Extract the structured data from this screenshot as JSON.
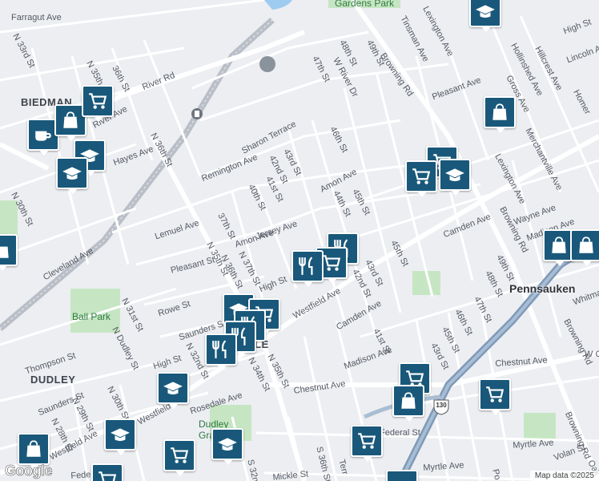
{
  "map": {
    "streets": [
      "Farragut Ave",
      "N 33rd St",
      "N 35th St",
      "36th St",
      "River Ave",
      "River Rd",
      "Hayes Ave",
      "N 36th St",
      "N 30th St",
      "Cleveland Ave",
      "Lemuel Ave",
      "Pleasant St",
      "N 35th St",
      "N 36th St",
      "37th St",
      "N 37th St",
      "Amon Ave",
      "Jersey Ave",
      "High St",
      "Rowe St",
      "N 31st St",
      "N Dudley St",
      "Saunders St",
      "N 32nd St",
      "N 34th St",
      "N 35th St",
      "High St",
      "Thompson St",
      "Saunders St",
      "N 30th St",
      "N 29th St",
      "N 28th St",
      "Westfield Ave",
      "Rosedale Ave",
      "Westfield Ave",
      "Sharon Terrace",
      "Remington Ave",
      "42nd St",
      "43rd St",
      "41st St",
      "40th St",
      "Amon Ave",
      "44th St",
      "45th St",
      "46th St",
      "47th St",
      "48th St",
      "W River Dr",
      "49th St",
      "Browning Rd",
      "Tinsman Ave",
      "Lexington Ave",
      "Pleasant Ave",
      "Gross Ave",
      "Hollinshed Ave",
      "Hillcrest Ave",
      "High St",
      "Lincoln Ave",
      "Homer",
      "Merchantville Ave",
      "Lexington Ave",
      "Wayne Ave",
      "Camden Ave",
      "Madison Ave",
      "Browning Rd",
      "49th St",
      "48th St",
      "47th St",
      "45th St",
      "43rd St",
      "42nd St",
      "Camden Ave",
      "41st St",
      "Madison Ave",
      "45th St",
      "46th St",
      "43rd St",
      "Chestnut Ave",
      "Chestnut Ave",
      "W C",
      "Whitman",
      "Browning Rd",
      "Federal St",
      "Myrtle Ave",
      "Myrtle Ave",
      "Volan St",
      "Mickle St",
      "S 36th St",
      "S 32nd",
      "Terr",
      "Oak",
      "Po",
      "Browning Rd",
      "Fede",
      "Westfield Ave"
    ],
    "areas": [
      "BIEDMAN",
      "DUDLEY"
    ],
    "cities": [
      "Pennsauken"
    ],
    "parks": [
      "Gardens Park",
      "Ball Park",
      "Dudley Grange"
    ],
    "route_shield": "130",
    "partial_label": "LE"
  },
  "footer": {
    "attribution": "Map data ©2025",
    "logo": "Google"
  },
  "colors": {
    "pin": "#19587a",
    "park": "#c6e6c3",
    "highway": "#7e9ab9",
    "road": "#ffffff"
  },
  "pins": [
    {
      "name": "coffee-cafe-pin",
      "icon": "coffee-icon"
    },
    {
      "name": "shopping-bag-pin",
      "icon": "shopping-bag-icon"
    },
    {
      "name": "grocery-cart-pin",
      "icon": "shopping-cart-icon"
    },
    {
      "name": "school-pin",
      "icon": "graduation-cap-icon"
    },
    {
      "name": "restaurant-pin",
      "icon": "utensils-icon"
    }
  ]
}
